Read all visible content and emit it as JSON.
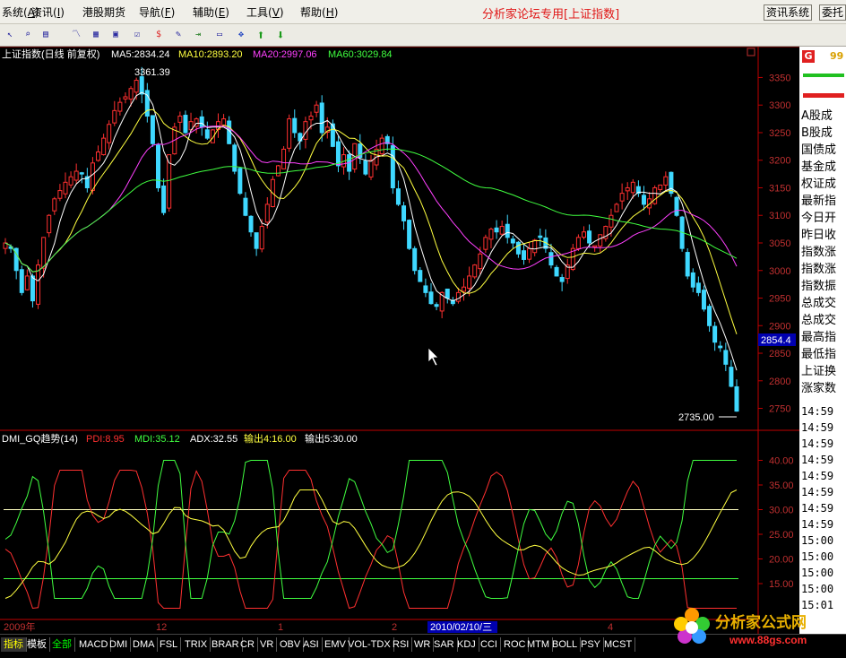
{
  "menu": {
    "items": [
      {
        "label": "系统",
        "hotkey": "A"
      },
      {
        "label": "资讯",
        "hotkey": "I"
      },
      {
        "label": "港股期货",
        "hotkey": ""
      },
      {
        "label": "导航",
        "hotkey": "F"
      },
      {
        "label": "辅助",
        "hotkey": "E"
      },
      {
        "label": "工具",
        "hotkey": "V"
      },
      {
        "label": "帮助",
        "hotkey": "H"
      }
    ],
    "forum_title": "分析家论坛专用[上证指数]",
    "info_system_button": "资讯系统",
    "secret_button": "委托"
  },
  "toolbar": {
    "buttons": [
      "cursor-icon",
      "zoom-icon",
      "f10-icon",
      "kline-icon",
      "rsi-icon",
      "grid-icon",
      "dollar-icon",
      "tools-icon",
      "export-icon",
      "move-icon",
      "up-arrow-icon",
      "down-arrow-icon"
    ]
  },
  "main_chart": {
    "title": "上证指数(日线 前复权)",
    "ma5": "MA5:2834.24",
    "ma10": "MA10:2893.20",
    "ma20": "MA20:2997.06",
    "ma60": "MA60:3029.84",
    "high_annotation": "3361.39",
    "low_annotation": "2735.00",
    "current_price_tag": "2854.4",
    "y_ticks": [
      "3350",
      "3300",
      "3250",
      "3200",
      "3150",
      "3100",
      "3050",
      "3000",
      "2950",
      "2900",
      "2850",
      "2800",
      "2750"
    ],
    "y_range": [
      2720,
      3380
    ]
  },
  "sub_chart": {
    "title": "DMI_GQ趋势(14)",
    "pdi": "PDI:8.95",
    "mdi": "MDI:35.12",
    "adx": "ADX:32.55",
    "out1": "输出4:16.00",
    "out2": "输出5:30.00",
    "y_ticks": [
      "40.00",
      "35.00",
      "30.00",
      "25.00",
      "20.00",
      "15.00"
    ],
    "y_range": [
      9,
      43
    ],
    "lines": [
      30,
      16
    ]
  },
  "x_axis": {
    "labels": [
      "2009年",
      "12",
      "1",
      "2",
      "2010/02/10/三",
      "4"
    ]
  },
  "right_panel": {
    "badge": "G",
    "code": "99",
    "rows": [
      "A股成",
      "B股成",
      "国债成",
      "基金成",
      "权证成",
      "最新指",
      "今日开",
      "昨日收",
      "指数涨",
      "指数涨",
      "指数振",
      "总成交",
      "总成交",
      "最高指",
      "最低指",
      "上证换",
      "涨家数"
    ],
    "times": [
      "14:59",
      "14:59",
      "14:59",
      "14:59",
      "14:59",
      "14:59",
      "14:59",
      "14:59",
      "15:00",
      "15:00",
      "15:00",
      "15:00",
      "15:01"
    ]
  },
  "bottom_tabs": [
    "指标",
    "模板",
    "全部",
    "MACD",
    "DMI",
    "DMA",
    "FSL",
    "TRIX",
    "BRAR",
    "CR",
    "VR",
    "OBV",
    "ASI",
    "EMV",
    "VOL-TDX",
    "RSI",
    "WR",
    "SAR",
    "KDJ",
    "CCI",
    "ROC",
    "MTM",
    "BOLL",
    "PSY",
    "MCST"
  ],
  "logo": {
    "text": "分析家公式网",
    "url": "www.88gs.com"
  },
  "colors": {
    "up": "#ff3030",
    "down": "#3fd8ff",
    "ma5": "#ffffff",
    "ma10": "#ffff40",
    "ma20": "#ff40ff",
    "ma60": "#40ff40",
    "axis": "#c00000",
    "label": "#c03030"
  },
  "chart_data": {
    "type": "candlestick",
    "closes": [
      3050,
      3040,
      3000,
      2960,
      2990,
      2945,
      3010,
      3060,
      3100,
      3130,
      3145,
      3160,
      3170,
      3180,
      3175,
      3150,
      3195,
      3215,
      3240,
      3265,
      3290,
      3305,
      3315,
      3330,
      3345,
      3320,
      3280,
      3230,
      3150,
      3105,
      3210,
      3260,
      3280,
      3250,
      3270,
      3275,
      3260,
      3240,
      3255,
      3270,
      3275,
      3230,
      3180,
      3140,
      3100,
      3070,
      3040,
      3080,
      3120,
      3165,
      3190,
      3220,
      3275,
      3250,
      3235,
      3270,
      3280,
      3300,
      3250,
      3260,
      3225,
      3190,
      3210,
      3180,
      3230,
      3205,
      3175,
      3200,
      3220,
      3240,
      3230,
      3150,
      3120,
      3090,
      3040,
      3000,
      2980,
      2960,
      2940,
      2935,
      2960,
      2950,
      2940,
      2960,
      2970,
      2990,
      3010,
      3030,
      3060,
      3075,
      3070,
      3080,
      3060,
      3050,
      3030,
      3020,
      3040,
      3055,
      3060,
      3040,
      3010,
      2990,
      2980,
      3010,
      3040,
      3060,
      3070,
      3050,
      3045,
      3065,
      3080,
      3100,
      3120,
      3140,
      3150,
      3160,
      3140,
      3120,
      3130,
      3150,
      3155,
      3170,
      3140,
      3100,
      3040,
      2990,
      2970,
      2960,
      2930,
      2900,
      2870,
      2860,
      2830,
      2790,
      2745
    ]
  }
}
